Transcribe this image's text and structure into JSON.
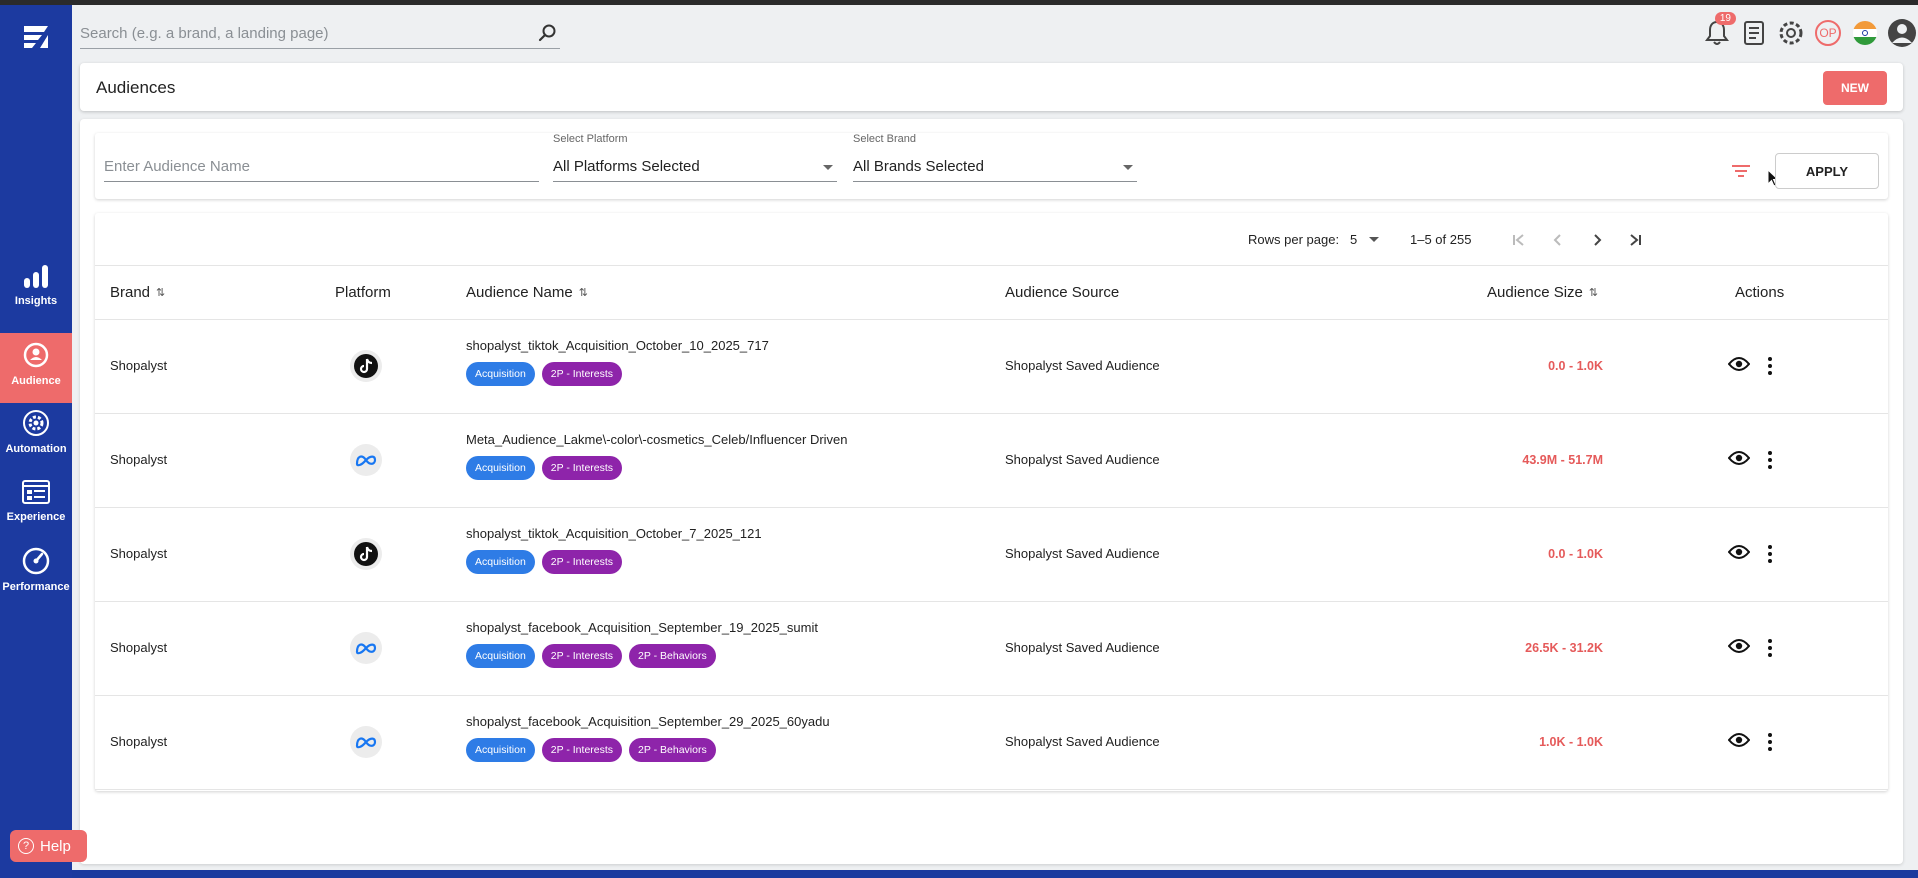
{
  "search": {
    "placeholder": "Search (e.g. a brand, a landing page)"
  },
  "notifications": {
    "count": "19"
  },
  "user": {
    "initials": "OP"
  },
  "sidebar": {
    "items": [
      {
        "label": "Insights",
        "icon": "bar-chart-icon",
        "active": false
      },
      {
        "label": "Audience",
        "icon": "target-icon",
        "active": true
      },
      {
        "label": "Automation",
        "icon": "gear-icon",
        "active": false
      },
      {
        "label": "Experience",
        "icon": "browser-icon",
        "active": false
      },
      {
        "label": "Performance",
        "icon": "speedometer-icon",
        "active": false
      }
    ],
    "help_label": "Help"
  },
  "page": {
    "title": "Audiences",
    "new_label": "NEW"
  },
  "filters": {
    "name_placeholder": "Enter Audience Name",
    "platform_label": "Select Platform",
    "platform_value": "All Platforms Selected",
    "brand_label": "Select Brand",
    "brand_value": "All Brands Selected",
    "apply_label": "APPLY"
  },
  "pagination": {
    "rows_per_page_label": "Rows per page:",
    "rows_per_page": "5",
    "range": "1–5 of 255"
  },
  "table": {
    "columns": [
      "Brand",
      "Platform",
      "Audience Name",
      "Audience Source",
      "Audience Size",
      "Actions"
    ],
    "rows": [
      {
        "brand": "Shopalyst",
        "platform": "tiktok",
        "name": "shopalyst_tiktok_Acquisition_October_10_2025_717",
        "tags": [
          "Acquisition",
          "2P - Interests"
        ],
        "source": "Shopalyst Saved Audience",
        "size": "0.0 - 1.0K"
      },
      {
        "brand": "Shopalyst",
        "platform": "meta",
        "name": "Meta_Audience_Lakme\\-color\\-cosmetics_Celeb/Influencer Driven",
        "tags": [
          "Acquisition",
          "2P - Interests"
        ],
        "source": "Shopalyst Saved Audience",
        "size": "43.9M - 51.7M"
      },
      {
        "brand": "Shopalyst",
        "platform": "tiktok",
        "name": "shopalyst_tiktok_Acquisition_October_7_2025_121",
        "tags": [
          "Acquisition",
          "2P - Interests"
        ],
        "source": "Shopalyst Saved Audience",
        "size": "0.0 - 1.0K"
      },
      {
        "brand": "Shopalyst",
        "platform": "meta",
        "name": "shopalyst_facebook_Acquisition_September_19_2025_sumit",
        "tags": [
          "Acquisition",
          "2P - Interests",
          "2P - Behaviors"
        ],
        "source": "Shopalyst Saved Audience",
        "size": "26.5K - 31.2K"
      },
      {
        "brand": "Shopalyst",
        "platform": "meta",
        "name": "shopalyst_facebook_Acquisition_September_29_2025_60yadu",
        "tags": [
          "Acquisition",
          "2P - Interests",
          "2P - Behaviors"
        ],
        "source": "Shopalyst Saved Audience",
        "size": "1.0K - 1.0K"
      }
    ]
  }
}
